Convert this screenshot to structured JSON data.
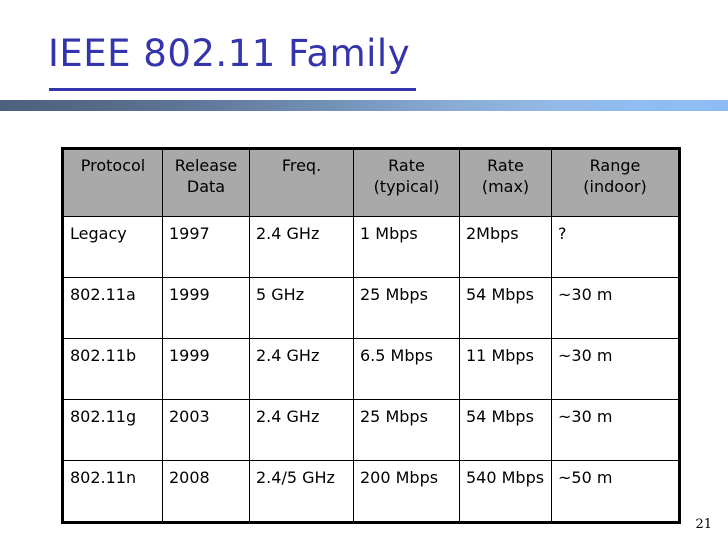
{
  "slide": {
    "title": "IEEE 802.11 Family",
    "title_color": "#3434ad",
    "page_number": "21",
    "accent_bar": {
      "color_left": "#4c617d",
      "color_right": "#8dbcf4"
    }
  },
  "table": {
    "header_background": "#a9a9a9",
    "border_color": "#000000",
    "columns": [
      "Protocol",
      "Release Data",
      "Freq.",
      "Rate (typical)",
      "Rate (max)",
      "Range (indoor)"
    ],
    "columns_multiline": [
      [
        "Protocol"
      ],
      [
        "Release",
        "Data"
      ],
      [
        "Freq."
      ],
      [
        "Rate",
        "(typical)"
      ],
      [
        "Rate",
        "(max)"
      ],
      [
        "Range",
        "(indoor)"
      ]
    ],
    "rows": [
      {
        "protocol": "Legacy",
        "release_data": "1997",
        "freq": "2.4 GHz",
        "rate_typical": "1 Mbps",
        "rate_max": "2Mbps",
        "range_indoor": "?"
      },
      {
        "protocol": "802.11a",
        "release_data": "1999",
        "freq": "5 GHz",
        "rate_typical": "25 Mbps",
        "rate_max": "54 Mbps",
        "range_indoor": "~30 m"
      },
      {
        "protocol": "802.11b",
        "release_data": "1999",
        "freq": "2.4 GHz",
        "rate_typical": "6.5 Mbps",
        "rate_max": "11 Mbps",
        "range_indoor": "~30 m"
      },
      {
        "protocol": "802.11g",
        "release_data": "2003",
        "freq": "2.4 GHz",
        "rate_typical": "25 Mbps",
        "rate_max": "54 Mbps",
        "range_indoor": "~30 m"
      },
      {
        "protocol": "802.11n",
        "release_data": "2008",
        "freq": "2.4/5 GHz",
        "rate_typical": "200 Mbps",
        "rate_max": "540 Mbps",
        "range_indoor": "~50 m"
      }
    ]
  }
}
